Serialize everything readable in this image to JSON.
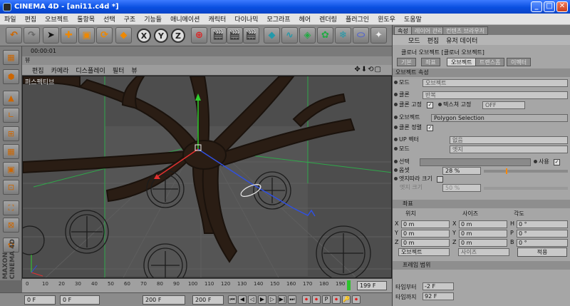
{
  "window": {
    "title": "CINEMA 4D - [ani11.c4d *]",
    "min": "_",
    "max": "□",
    "close": "✕"
  },
  "menu": [
    "파일",
    "편집",
    "오브젝트",
    "툴항목",
    "선택",
    "구조",
    "기능들",
    "애니메이션",
    "캐릭터",
    "다이나믹",
    "모그라프",
    "헤어",
    "렌더링",
    "플러그인",
    "윈도우",
    "도움말"
  ],
  "toolbar": {
    "x": "X",
    "y": "Y",
    "z": "Z"
  },
  "timeline_head": "00:00:01",
  "view_strip": "뷰",
  "view_menu": [
    "편집",
    "카메라",
    "디스플레이",
    "필터",
    "뷰"
  ],
  "nav_icons": "✥⬇⟲▢",
  "viewport_label": "퍼스펙티브",
  "timeline": {
    "ticks": [
      "0",
      "10",
      "20",
      "30",
      "40",
      "50",
      "60",
      "70",
      "80",
      "90",
      "100",
      "110",
      "120",
      "130",
      "140",
      "150",
      "160",
      "170",
      "180",
      "190"
    ],
    "end": "199 F",
    "progress": 0.95
  },
  "status": {
    "start": "0 F",
    "mid1": "0 F",
    "mid2": "200 F",
    "end": "200 F",
    "controls": [
      "⏮",
      "◀",
      "◁",
      "▶",
      "▷",
      "▶|",
      "⏭",
      "⏺",
      "⏺",
      "P",
      "⏺",
      "🔑",
      "⏺"
    ]
  },
  "attr": {
    "tabs": [
      "속성",
      "레이어 관리",
      "컨텐츠 브라우저"
    ],
    "menu": [
      "모드",
      "편집",
      "유저 데이터"
    ],
    "header": "클로너 오브젝트 [클로너 오브젝트]",
    "subtabs": [
      "기본",
      "좌표",
      "오브젝트",
      "트랜스폼",
      "이펙터"
    ],
    "section": "오브젝트 속성",
    "mode_label": "모드",
    "mode_value": "오브젝트",
    "clones_label": "클론",
    "clones_value": "반복",
    "fix_label": "클론 고정",
    "tex_label": "텍스쳐 고정",
    "tex_value": "OFF",
    "object_label": "오브젝트",
    "object_value": "Polygon Selection",
    "align_label": "클론 정렬",
    "up_label": "UP 벡터",
    "up_value": "없음",
    "mode2_label": "모드",
    "mode2_value": "엣지",
    "select_label": "선택",
    "use_label": "사용",
    "offset_label": "옵셋",
    "offset_value": "28 %",
    "edge_scale_label": "엣지따라 크기",
    "edge_size_label": "엣지 크기",
    "edge_size_value": "50 %",
    "coord_section": "좌표",
    "col_pos": "위치",
    "col_size": "사이즈",
    "col_angle": "각도",
    "rows": [
      {
        "a": "X",
        "av": "0 m",
        "b": "X",
        "bv": "0 m",
        "c": "H",
        "cv": "0 °"
      },
      {
        "a": "Y",
        "av": "0 m",
        "b": "Y",
        "bv": "0 m",
        "c": "P",
        "cv": "0 °"
      },
      {
        "a": "Z",
        "av": "0 m",
        "b": "Z",
        "bv": "0 m",
        "c": "B",
        "cv": "0 °"
      }
    ],
    "coord_mode": "오브젝트",
    "coord_size": "사이즈",
    "apply": "적용",
    "frame_section": "프레임 범위",
    "from_label": "타임부터",
    "from_value": "-2 F",
    "to_label": "타임까지",
    "to_value": "92 F"
  },
  "colors": {
    "title": "#0a4fe0",
    "viewport": "#4a4a4a",
    "panel": "#a6a6a6",
    "accent": "#ff8800"
  }
}
